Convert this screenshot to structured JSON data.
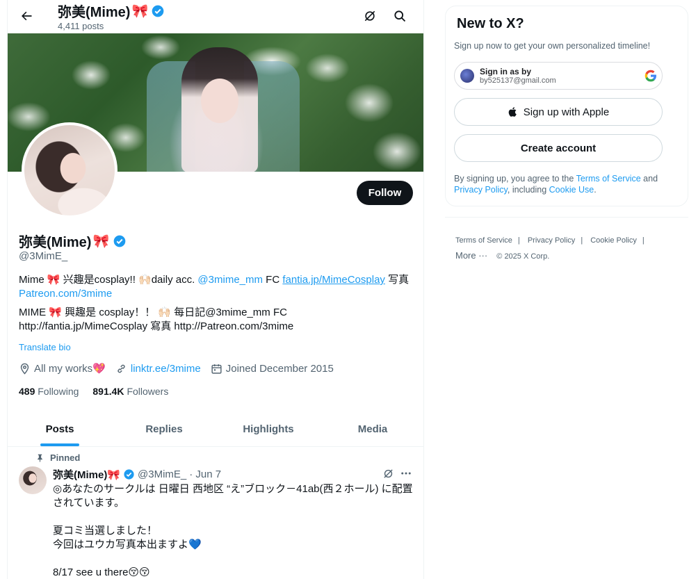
{
  "header": {
    "name": "弥美(Mime)",
    "posts_count": "4,411 posts"
  },
  "profile": {
    "name": "弥美(Mime)",
    "handle": "@3MimE_",
    "follow_label": "Follow",
    "bio_line1_a": "Mime 🎀 兴趣是cosplay!! 🙌🏻daily acc. ",
    "bio_line1_mention": "@3mime_mm",
    "bio_line1_b": " FC ",
    "bio_line1_link": "fantia.jp/MimeCosplay",
    "bio_line1_c": " 写真",
    "bio_line1_link2": "Patreon.com/3mime",
    "bio_translated": "MIME 🎀 興趣是 cosplay！！ 🙌🏻 每日記@3mime_mm FC http://fantia.jp/MimeCosplay 寫真 http://Patreon.com/3mime",
    "translate_label": "Translate bio",
    "location": "All my works💖",
    "website": "linktr.ee/3mime",
    "joined": "Joined December 2015",
    "following_count": "489",
    "following_label": "Following",
    "followers_count": "891.4K",
    "followers_label": "Followers"
  },
  "tabs": [
    {
      "label": "Posts",
      "active": true
    },
    {
      "label": "Replies",
      "active": false
    },
    {
      "label": "Highlights",
      "active": false
    },
    {
      "label": "Media",
      "active": false
    }
  ],
  "tweet": {
    "pinned_label": "Pinned",
    "name": "弥美(Mime)🎀",
    "handle": "@3MimE_",
    "date": "· Jun 7",
    "lines": [
      "◎あなたのサークルは 日曜日 西地区 “え”ブロック－41ab(西２ホール) に配置されています。",
      "",
      "夏コミ当選しました！",
      "今回はユウカ写真本出ますよ💙",
      "",
      "8/17 see u there😚😚"
    ]
  },
  "signup": {
    "title": "New to X?",
    "subtitle": "Sign up now to get your own personalized timeline!",
    "google_line1": "Sign in as by",
    "google_line2": "by525137@gmail.com",
    "apple_label": "Sign up with Apple",
    "create_label": "Create account",
    "legal_a": "By signing up, you agree to the ",
    "legal_tos": "Terms of Service",
    "legal_b": " and ",
    "legal_privacy": "Privacy Policy",
    "legal_c": ", including ",
    "legal_cookie": "Cookie Use",
    "legal_d": "."
  },
  "footer": {
    "terms": "Terms of Service",
    "privacy": "Privacy Policy",
    "cookie": "Cookie Policy",
    "more": "More ···",
    "copyright": "© 2025 X Corp."
  },
  "colors": {
    "accent": "#1d9bf0",
    "text": "#0f1419",
    "muted": "#536471",
    "verified": "#1d9bf0"
  }
}
